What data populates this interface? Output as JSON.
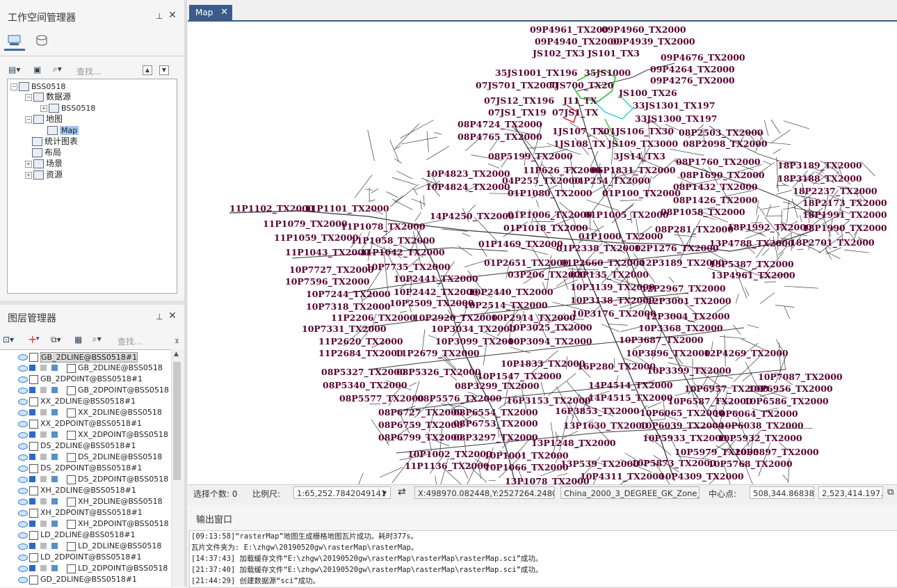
{
  "workspace": {
    "title": "工作空间管理器",
    "search_placeholder": "查找...",
    "tree": [
      {
        "label": "BSS0518",
        "level": 0,
        "selected": false
      },
      {
        "label": "数据源",
        "level": 1,
        "selected": false
      },
      {
        "label": "BSS0518",
        "level": 2,
        "selected": false
      },
      {
        "label": "地图",
        "level": 1,
        "selected": false
      },
      {
        "label": "Map",
        "level": 2,
        "selected": true
      },
      {
        "label": "统计图表",
        "level": 1,
        "selected": false
      },
      {
        "label": "布局",
        "level": 1,
        "selected": false
      },
      {
        "label": "场景",
        "level": 1,
        "selected": false
      },
      {
        "label": "资源",
        "level": 1,
        "selected": false
      }
    ]
  },
  "layers": {
    "title": "图层管理器",
    "search_placeholder": "查找...",
    "items": [
      {
        "label": "GB_2DLINE@BSS0518#1",
        "sub": false,
        "selected": true
      },
      {
        "label": "GB_2DLINE@BSS0518",
        "sub": true,
        "selected": false
      },
      {
        "label": "GB_2DPOINT@BSS0518#1",
        "sub": false,
        "selected": false
      },
      {
        "label": "GB_2DPOINT@BSS0518",
        "sub": true,
        "selected": false
      },
      {
        "label": "XX_2DLINE@BSS0518#1",
        "sub": false,
        "selected": false
      },
      {
        "label": "XX_2DLINE@BSS0518",
        "sub": true,
        "selected": false
      },
      {
        "label": "XX_2DPOINT@BSS0518#1",
        "sub": false,
        "selected": false
      },
      {
        "label": "XX_2DPOINT@BSS0518",
        "sub": true,
        "selected": false
      },
      {
        "label": "DS_2DLINE@BSS0518#1",
        "sub": false,
        "selected": false
      },
      {
        "label": "DS_2DLINE@BSS0518",
        "sub": true,
        "selected": false
      },
      {
        "label": "DS_2DPOINT@BSS0518#1",
        "sub": false,
        "selected": false
      },
      {
        "label": "DS_2DPOINT@BSS0518",
        "sub": true,
        "selected": false
      },
      {
        "label": "XH_2DLINE@BSS0518#1",
        "sub": false,
        "selected": false
      },
      {
        "label": "XH_2DLINE@BSS0518",
        "sub": true,
        "selected": false
      },
      {
        "label": "XH_2DPOINT@BSS0518#1",
        "sub": false,
        "selected": false
      },
      {
        "label": "XH_2DPOINT@BSS0518",
        "sub": true,
        "selected": false
      },
      {
        "label": "LD_2DLINE@BSS0518#1",
        "sub": false,
        "selected": false
      },
      {
        "label": "LD_2DLINE@BSS0518",
        "sub": true,
        "selected": false
      },
      {
        "label": "LD_2DPOINT@BSS0518#1",
        "sub": false,
        "selected": false
      },
      {
        "label": "LD_2DPOINT@BSS0518",
        "sub": true,
        "selected": false
      },
      {
        "label": "GD_2DLINE@BSS0518#1",
        "sub": false,
        "selected": false
      }
    ]
  },
  "map": {
    "tab_label": "Map",
    "labels": [
      "09P4961_TX200",
      "09P4960_TX2000",
      "09P4940_TX2000",
      "09P4939_TX2000",
      "JS102_TX3",
      "JS101_TX3",
      "09P4676_TX2000",
      "35JS1001_TX196",
      "35JS1000",
      "09P4264_TX2000",
      "07JS701_TX2000",
      "7JS700_TX20",
      "09P4276_TX2000",
      "JS100_TX26",
      "07JS12_TX196",
      "J11_TX",
      "33JS1301_TX197",
      "07JS1_TX19",
      "07JS1_TX",
      "33JS1300_TX197",
      "08P4724_TX2000",
      "1JS107_TX",
      "01JS106_TX30",
      "08P2503_TX2000",
      "08P4765_TX2000",
      "1JS108_TX",
      "JS109_TX3000",
      "08P2098_TX2000",
      "08P5199_TX2000",
      "3JS14_TX3",
      "08P1760_TX2000",
      "18P3189_TX2000",
      "10P4823_TX2000",
      "11P626_TX2000",
      "06P1831_TX2000",
      "08P1690_TX2000",
      "18P3188_TX2000",
      "04P255_TX2000",
      "04P254_TX2000",
      "10P4824_TX2000",
      "08P1432_TX2000",
      "18P2237_TX2000",
      "01P1080_TX2000",
      "01P100_TX2000",
      "08P1426_TX2000",
      "18P2173_TX2000",
      "11P1102_TX2000",
      "11P1101_TX2000",
      "18P1991_TX2000",
      "14P4250_TX2000",
      "01P1006_TX2000",
      "01P1005_TX2000",
      "08P1058_TX2000",
      "11P1079_TX2000",
      "11P1078_TX2000",
      "01P1018_TX2000",
      "18P1992_TX2000",
      "18P1990_TX2000",
      "08P281_TX2000",
      "11P1059_TX2000",
      "11P1058_TX2000",
      "01P1000_TX2000",
      "13P4788_TX2000",
      "18P2701_TX2000",
      "01P1469_TX2000",
      "01P2338_TX2000",
      "12P1276_TX2000",
      "11P1043_TX2000",
      "11P1042_TX2000",
      "01P2651_TX2000",
      "01P2660_TX2000",
      "12P3189_TX2000",
      "13P5387_TX2000",
      "10P7727_TX2000",
      "10P7735_TX2000",
      "03P206_TX2000",
      "03P135_TX2000",
      "13P4961_TX2000",
      "10P7596_TX2000",
      "10P2441_TX2000",
      "10P7244_TX2000",
      "10P2442_TX2000",
      "10P2440_TX2000",
      "10P3139_TX2000",
      "12P2967_TX2000",
      "10P7318_TX2000",
      "10P2509_TX2000",
      "10P2514_TX2000",
      "10P3138_TX2000",
      "12P3001_TX2000",
      "11P2206_TX2000",
      "10P2920_TX2000",
      "10P2914_TX2000",
      "10P3176_TX2000",
      "12P3004_TX2000",
      "10P7331_TX2000",
      "10P3034_TX2000",
      "10P3025_TX2000",
      "10P3368_TX2000",
      "11P2620_TX2000",
      "10P3099_TX2000",
      "10P3094_TX2000",
      "10P3687_TX2000",
      "11P2684_TX2000",
      "11P2679_TX2000",
      "10P3896_TX2000",
      "12P4269_TX2000",
      "10P1833_TX2000",
      "16P280_TX2000",
      "10P3399_TX2000",
      "08P5327_TX2000",
      "08P5326_TX2000",
      "10P1547_TX2000",
      "10P7087_TX2000",
      "08P5340_TX2000",
      "08P3299_TX2000",
      "14P4514_TX2000",
      "10P6957_TX2000",
      "10P6956_TX2000",
      "08P5577_TX2000",
      "08P5576_TX2000",
      "16P3153_TX2000",
      "14P4515_TX2000",
      "10P6587_TX2000",
      "10P6586_TX2000",
      "08P6727_TX2000",
      "08P6554_TX2000",
      "16P3853_TX2000",
      "10P6065_TX2000",
      "10P6064_TX2000",
      "08P6759_TX2000",
      "08P6753_TX2000",
      "13P1630_TX2000",
      "10P6039_TX2000",
      "10P6038_TX2000",
      "08P6799_TX2000",
      "08P3297_TX2000",
      "10P5933_TX2000",
      "10P5932_TX2000",
      "13P1248_TX2000",
      "10P1002_TX2000",
      "10P1001_TX2000",
      "10P5979_TX2000",
      "10P5897_TX2000",
      "11P1136_TX2000",
      "10P1066_TX2000",
      "13P539_TX2000",
      "10P5873_TX2000",
      "10P5768_TX2000",
      "10P4311_TX2000",
      "10P4309_TX2000",
      "13P1078_TX2000"
    ]
  },
  "status": {
    "selected_count_label": "选择个数: 0",
    "scale_label": "比例尺:",
    "scale_value": "1:65,252.7842049141",
    "coords": "X:498970.082448,Y:2527264.248050",
    "crs": "China_2000_3_DEGREE_GK_Zone_38N",
    "center_label": "中心点:",
    "center_x": "508,344.868389",
    "center_y": "2,523,414.197..."
  },
  "output": {
    "title": "输出窗口",
    "lines": [
      "[09:13:58]“rasterMap”地图生成栅格地图瓦片成功。耗时377s。",
      "瓦片文件夹为: E:\\zhgw\\20190520gw\\rasterMap\\rasterMap。",
      "[14:37:43] 加载缓存文件“E:\\zhgw\\20190520gw\\rasterMap\\rasterMap\\rasterMap.sci”成功。",
      "[21:37:40] 加载缓存文件“E:\\zhgw\\20190520gw\\rasterMap\\rasterMap\\rasterMap.sci”成功。",
      "[21:44:29] 创建数据源“sci”成功。"
    ]
  },
  "colors": {
    "label": "#5a0032",
    "road": "#3a3a3a",
    "tab_active": "#3b5b8a",
    "selection": "#9ec5ee",
    "green_feature": "#1fbf1f",
    "cyan_feature": "#20c8e0",
    "red_feature": "#e02020"
  }
}
